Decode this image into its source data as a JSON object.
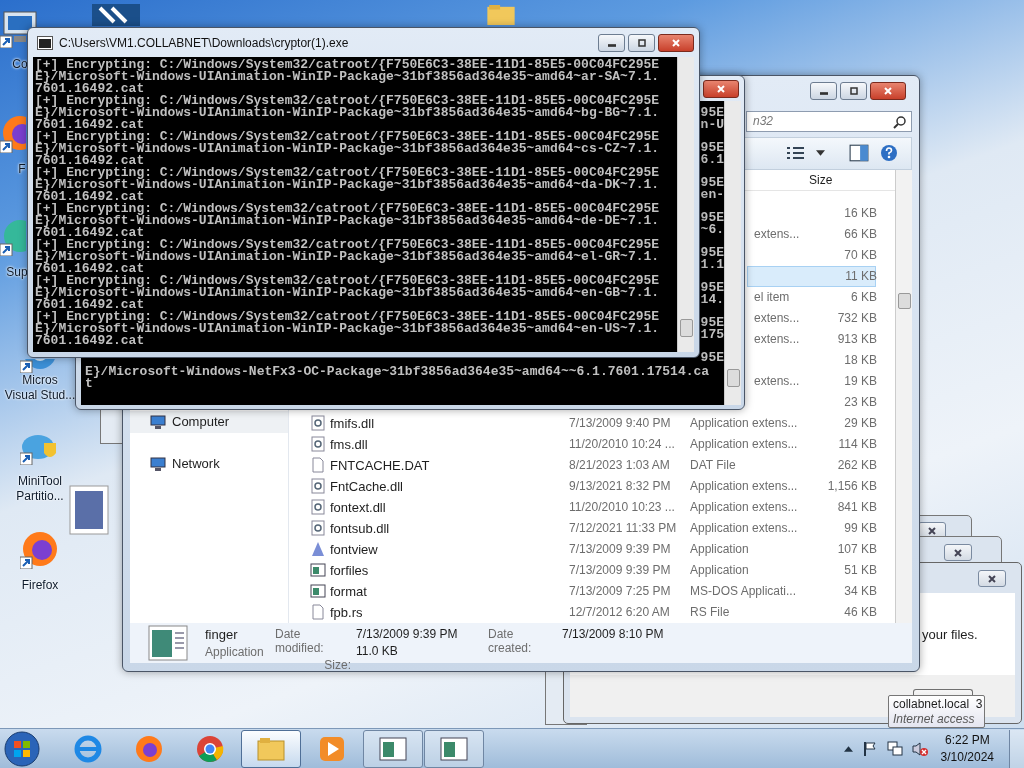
{
  "desktop_icons": [
    {
      "kind": "computer",
      "lines": [
        "Co"
      ]
    },
    {
      "kind": "firefox",
      "lines": [
        "F"
      ]
    },
    {
      "kind": "app",
      "lines": [
        "Sup"
      ]
    },
    {
      "kind": "visualstudio",
      "lines": [
        "Micros",
        "Visual Stud..."
      ]
    },
    {
      "kind": "minitool",
      "lines": [
        "MiniTool",
        "Partitio..."
      ]
    },
    {
      "kind": "firefox",
      "lines": [
        "Firefox"
      ]
    }
  ],
  "front_console": {
    "title": "C:\\Users\\VM1.COLLABNET\\Downloads\\cryptor(1).exe",
    "lines": [
      "[+] Encrypting: C:/Windows/System32/catroot/{F750E6C3-38EE-11D1-85E5-00C04FC295E",
      "E}/Microsoft-Windows-UIAnimation-WinIP-Package~31bf3856ad364e35~amd64~ar-SA~7.1.",
      "7601.16492.cat",
      "[+] Encrypting: C:/Windows/System32/catroot/{F750E6C3-38EE-11D1-85E5-00C04FC295E",
      "E}/Microsoft-Windows-UIAnimation-WinIP-Package~31bf3856ad364e35~amd64~bg-BG~7.1.",
      "7601.16492.cat",
      "[+] Encrypting: C:/Windows/System32/catroot/{F750E6C3-38EE-11D1-85E5-00C04FC295E",
      "E}/Microsoft-Windows-UIAnimation-WinIP-Package~31bf3856ad364e35~amd64~cs-CZ~7.1.",
      "7601.16492.cat",
      "[+] Encrypting: C:/Windows/System32/catroot/{F750E6C3-38EE-11D1-85E5-00C04FC295E",
      "E}/Microsoft-Windows-UIAnimation-WinIP-Package~31bf3856ad364e35~amd64~da-DK~7.1.",
      "7601.16492.cat",
      "[+] Encrypting: C:/Windows/System32/catroot/{F750E6C3-38EE-11D1-85E5-00C04FC295E",
      "E}/Microsoft-Windows-UIAnimation-WinIP-Package~31bf3856ad364e35~amd64~de-DE~7.1.",
      "7601.16492.cat",
      "[+] Encrypting: C:/Windows/System32/catroot/{F750E6C3-38EE-11D1-85E5-00C04FC295E",
      "E}/Microsoft-Windows-UIAnimation-WinIP-Package~31bf3856ad364e35~amd64~el-GR~7.1.",
      "7601.16492.cat",
      "[+] Encrypting: C:/Windows/System32/catroot/{F750E6C3-38EE-11D1-85E5-00C04FC295E",
      "E}/Microsoft-Windows-UIAnimation-WinIP-Package~31bf3856ad364e35~amd64~en-GB~7.1.",
      "7601.16492.cat",
      "[+] Encrypting: C:/Windows/System32/catroot/{F750E6C3-38EE-11D1-85E5-00C04FC295E",
      "E}/Microsoft-Windows-UIAnimation-WinIP-Package~31bf3856ad364e35~amd64~en-US~7.1.",
      "7601.16492.cat"
    ]
  },
  "back_console": {
    "right_edge_fragments": [
      [
        "95E",
        "n-U"
      ],
      [
        "95E",
        "6.1"
      ],
      [
        "95E",
        "en-"
      ],
      [
        "95E",
        "~6."
      ],
      [
        "95E",
        "1.1"
      ],
      [
        "95E",
        "14."
      ],
      [
        "95E",
        "175"
      ],
      [
        "95E"
      ]
    ],
    "lines": [
      "E}/Microsoft-Windows-NetFx3-OC-Package~31bf3856ad364e35~amd64~~6.1.7601.17514.ca",
      "t"
    ]
  },
  "explorer": {
    "search": {
      "placeholder": "n32"
    },
    "size_column": "Size",
    "nav": [
      {
        "label": "Computer",
        "selected": true
      },
      {
        "label": "Network",
        "selected": false
      }
    ],
    "rows": [
      {
        "size": "16 KB",
        "selected": false
      },
      {
        "type": "extens...",
        "size": "66 KB",
        "selected": false
      },
      {
        "size": "70 KB",
        "selected": false
      },
      {
        "size": "11 KB",
        "selected": true
      },
      {
        "type": "el item",
        "size": "6 KB",
        "selected": false
      },
      {
        "type": "extens...",
        "size": "732 KB",
        "selected": false
      },
      {
        "type": "extens...",
        "size": "913 KB",
        "selected": false
      },
      {
        "size": "18 KB",
        "selected": false
      },
      {
        "type": "extens...",
        "size": "19 KB",
        "selected": false
      },
      {
        "size": "23 KB",
        "selected": false
      },
      {
        "kind": "dll",
        "name": "fmifs.dll",
        "date": "7/13/2009 9:40 PM",
        "type": "Application extens...",
        "size": "29 KB",
        "selected": false
      },
      {
        "kind": "dll",
        "name": "fms.dll",
        "date": "11/20/2010 10:24 ...",
        "type": "Application extens...",
        "size": "114 KB",
        "selected": false
      },
      {
        "kind": "file",
        "name": "FNTCACHE.DAT",
        "date": "8/21/2023 1:03 AM",
        "type": "DAT File",
        "size": "262 KB",
        "selected": false
      },
      {
        "kind": "dll",
        "name": "FntCache.dll",
        "date": "9/13/2021 8:32 PM",
        "type": "Application extens...",
        "size": "1,156 KB",
        "selected": false
      },
      {
        "kind": "dll",
        "name": "fontext.dll",
        "date": "11/20/2010 10:23 ...",
        "type": "Application extens...",
        "size": "841 KB",
        "selected": false
      },
      {
        "kind": "dll",
        "name": "fontsub.dll",
        "date": "7/12/2021 11:33 PM",
        "type": "Application extens...",
        "size": "99 KB",
        "selected": false
      },
      {
        "kind": "font",
        "name": "fontview",
        "date": "7/13/2009 9:39 PM",
        "type": "Application",
        "size": "107 KB",
        "selected": false
      },
      {
        "kind": "app",
        "name": "forfiles",
        "date": "7/13/2009 9:39 PM",
        "type": "Application",
        "size": "51 KB",
        "selected": false
      },
      {
        "kind": "app",
        "name": "format",
        "date": "7/13/2009 7:25 PM",
        "type": "MS-DOS Applicati...",
        "size": "34 KB",
        "selected": false
      },
      {
        "kind": "file",
        "name": "fpb.rs",
        "date": "12/7/2012 6:20 AM",
        "type": "RS File",
        "size": "46 KB",
        "selected": false
      }
    ],
    "details": {
      "name": "finger",
      "type": "Application",
      "modified_label": "Date modified:",
      "modified": "7/13/2009 9:39 PM",
      "size_label": "Size:",
      "size": "11.0 KB",
      "created_label": "Date created:",
      "created": "7/13/2009 8:10 PM"
    }
  },
  "dialog": {
    "message": "your files."
  },
  "tooltip": {
    "title": "collabnet.local",
    "count": "3",
    "subtitle": "Internet access"
  },
  "taskbar": {
    "apps": [
      {
        "kind": "ie",
        "open": false,
        "selected": false
      },
      {
        "kind": "firefox",
        "open": false,
        "selected": false
      },
      {
        "kind": "chrome",
        "open": false,
        "selected": false
      },
      {
        "kind": "explorer",
        "open": true,
        "selected": true
      },
      {
        "kind": "media",
        "open": false,
        "selected": false
      },
      {
        "kind": "console",
        "open": true,
        "selected": false
      },
      {
        "kind": "console",
        "open": true,
        "selected": false
      }
    ],
    "time": "6:22 PM",
    "date": "3/10/2024"
  }
}
